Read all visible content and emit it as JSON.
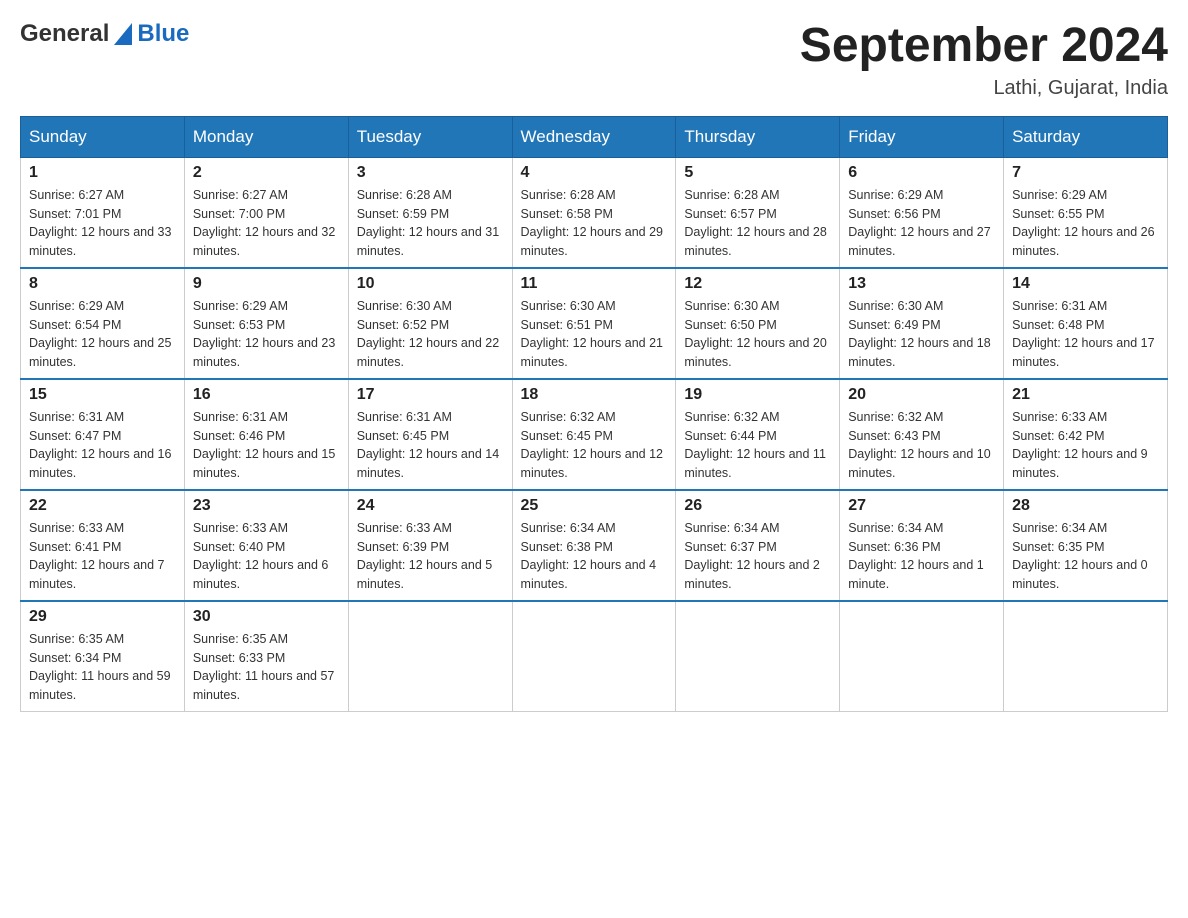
{
  "header": {
    "logo_general": "General",
    "logo_blue": "Blue",
    "calendar_title": "September 2024",
    "subtitle": "Lathi, Gujarat, India"
  },
  "days_of_week": [
    "Sunday",
    "Monday",
    "Tuesday",
    "Wednesday",
    "Thursday",
    "Friday",
    "Saturday"
  ],
  "weeks": [
    [
      {
        "day": "1",
        "sunrise": "Sunrise: 6:27 AM",
        "sunset": "Sunset: 7:01 PM",
        "daylight": "Daylight: 12 hours and 33 minutes."
      },
      {
        "day": "2",
        "sunrise": "Sunrise: 6:27 AM",
        "sunset": "Sunset: 7:00 PM",
        "daylight": "Daylight: 12 hours and 32 minutes."
      },
      {
        "day": "3",
        "sunrise": "Sunrise: 6:28 AM",
        "sunset": "Sunset: 6:59 PM",
        "daylight": "Daylight: 12 hours and 31 minutes."
      },
      {
        "day": "4",
        "sunrise": "Sunrise: 6:28 AM",
        "sunset": "Sunset: 6:58 PM",
        "daylight": "Daylight: 12 hours and 29 minutes."
      },
      {
        "day": "5",
        "sunrise": "Sunrise: 6:28 AM",
        "sunset": "Sunset: 6:57 PM",
        "daylight": "Daylight: 12 hours and 28 minutes."
      },
      {
        "day": "6",
        "sunrise": "Sunrise: 6:29 AM",
        "sunset": "Sunset: 6:56 PM",
        "daylight": "Daylight: 12 hours and 27 minutes."
      },
      {
        "day": "7",
        "sunrise": "Sunrise: 6:29 AM",
        "sunset": "Sunset: 6:55 PM",
        "daylight": "Daylight: 12 hours and 26 minutes."
      }
    ],
    [
      {
        "day": "8",
        "sunrise": "Sunrise: 6:29 AM",
        "sunset": "Sunset: 6:54 PM",
        "daylight": "Daylight: 12 hours and 25 minutes."
      },
      {
        "day": "9",
        "sunrise": "Sunrise: 6:29 AM",
        "sunset": "Sunset: 6:53 PM",
        "daylight": "Daylight: 12 hours and 23 minutes."
      },
      {
        "day": "10",
        "sunrise": "Sunrise: 6:30 AM",
        "sunset": "Sunset: 6:52 PM",
        "daylight": "Daylight: 12 hours and 22 minutes."
      },
      {
        "day": "11",
        "sunrise": "Sunrise: 6:30 AM",
        "sunset": "Sunset: 6:51 PM",
        "daylight": "Daylight: 12 hours and 21 minutes."
      },
      {
        "day": "12",
        "sunrise": "Sunrise: 6:30 AM",
        "sunset": "Sunset: 6:50 PM",
        "daylight": "Daylight: 12 hours and 20 minutes."
      },
      {
        "day": "13",
        "sunrise": "Sunrise: 6:30 AM",
        "sunset": "Sunset: 6:49 PM",
        "daylight": "Daylight: 12 hours and 18 minutes."
      },
      {
        "day": "14",
        "sunrise": "Sunrise: 6:31 AM",
        "sunset": "Sunset: 6:48 PM",
        "daylight": "Daylight: 12 hours and 17 minutes."
      }
    ],
    [
      {
        "day": "15",
        "sunrise": "Sunrise: 6:31 AM",
        "sunset": "Sunset: 6:47 PM",
        "daylight": "Daylight: 12 hours and 16 minutes."
      },
      {
        "day": "16",
        "sunrise": "Sunrise: 6:31 AM",
        "sunset": "Sunset: 6:46 PM",
        "daylight": "Daylight: 12 hours and 15 minutes."
      },
      {
        "day": "17",
        "sunrise": "Sunrise: 6:31 AM",
        "sunset": "Sunset: 6:45 PM",
        "daylight": "Daylight: 12 hours and 14 minutes."
      },
      {
        "day": "18",
        "sunrise": "Sunrise: 6:32 AM",
        "sunset": "Sunset: 6:45 PM",
        "daylight": "Daylight: 12 hours and 12 minutes."
      },
      {
        "day": "19",
        "sunrise": "Sunrise: 6:32 AM",
        "sunset": "Sunset: 6:44 PM",
        "daylight": "Daylight: 12 hours and 11 minutes."
      },
      {
        "day": "20",
        "sunrise": "Sunrise: 6:32 AM",
        "sunset": "Sunset: 6:43 PM",
        "daylight": "Daylight: 12 hours and 10 minutes."
      },
      {
        "day": "21",
        "sunrise": "Sunrise: 6:33 AM",
        "sunset": "Sunset: 6:42 PM",
        "daylight": "Daylight: 12 hours and 9 minutes."
      }
    ],
    [
      {
        "day": "22",
        "sunrise": "Sunrise: 6:33 AM",
        "sunset": "Sunset: 6:41 PM",
        "daylight": "Daylight: 12 hours and 7 minutes."
      },
      {
        "day": "23",
        "sunrise": "Sunrise: 6:33 AM",
        "sunset": "Sunset: 6:40 PM",
        "daylight": "Daylight: 12 hours and 6 minutes."
      },
      {
        "day": "24",
        "sunrise": "Sunrise: 6:33 AM",
        "sunset": "Sunset: 6:39 PM",
        "daylight": "Daylight: 12 hours and 5 minutes."
      },
      {
        "day": "25",
        "sunrise": "Sunrise: 6:34 AM",
        "sunset": "Sunset: 6:38 PM",
        "daylight": "Daylight: 12 hours and 4 minutes."
      },
      {
        "day": "26",
        "sunrise": "Sunrise: 6:34 AM",
        "sunset": "Sunset: 6:37 PM",
        "daylight": "Daylight: 12 hours and 2 minutes."
      },
      {
        "day": "27",
        "sunrise": "Sunrise: 6:34 AM",
        "sunset": "Sunset: 6:36 PM",
        "daylight": "Daylight: 12 hours and 1 minute."
      },
      {
        "day": "28",
        "sunrise": "Sunrise: 6:34 AM",
        "sunset": "Sunset: 6:35 PM",
        "daylight": "Daylight: 12 hours and 0 minutes."
      }
    ],
    [
      {
        "day": "29",
        "sunrise": "Sunrise: 6:35 AM",
        "sunset": "Sunset: 6:34 PM",
        "daylight": "Daylight: 11 hours and 59 minutes."
      },
      {
        "day": "30",
        "sunrise": "Sunrise: 6:35 AM",
        "sunset": "Sunset: 6:33 PM",
        "daylight": "Daylight: 11 hours and 57 minutes."
      },
      null,
      null,
      null,
      null,
      null
    ]
  ]
}
